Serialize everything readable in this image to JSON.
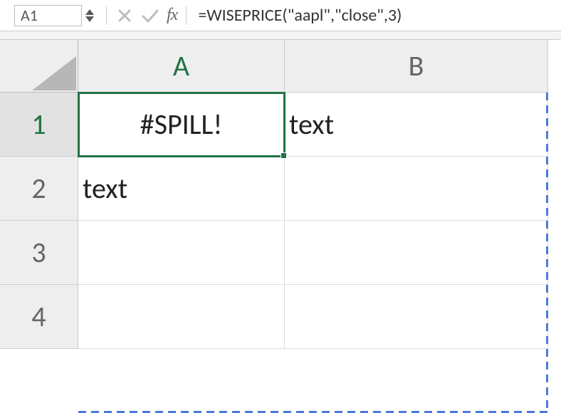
{
  "nameBox": {
    "value": "A1"
  },
  "formulaBar": {
    "formula": "=WISEPRICE(\"aapl\",\"close\",3)",
    "fxLabel": "fx"
  },
  "columns": [
    "A",
    "B"
  ],
  "rows": [
    "1",
    "2",
    "3",
    "4"
  ],
  "cells": {
    "A1": "#SPILL!",
    "B1": "text",
    "A2": "text",
    "B2": "",
    "A3": "",
    "B3": "",
    "A4": "",
    "B4": ""
  },
  "activeCell": "A1"
}
